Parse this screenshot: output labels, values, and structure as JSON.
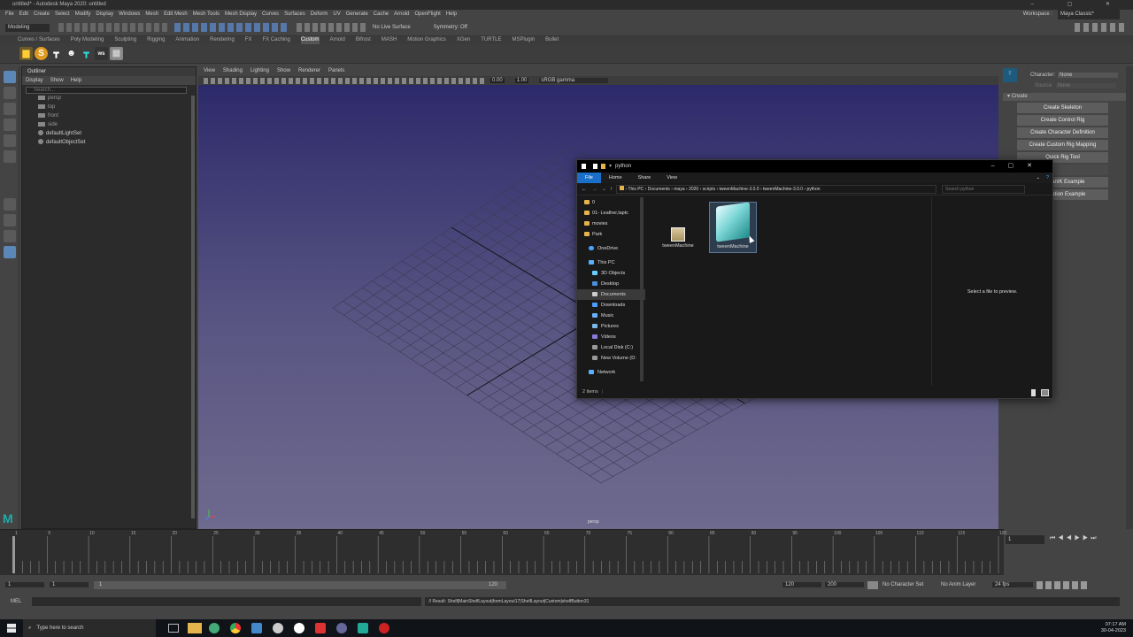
{
  "window": {
    "title": "untitled* - Autodesk Maya 2020: untitled"
  },
  "menubar": [
    "File",
    "Edit",
    "Create",
    "Select",
    "Modify",
    "Display",
    "Windows",
    "Mesh",
    "Edit Mesh",
    "Mesh Tools",
    "Mesh Display",
    "Curves",
    "Surfaces",
    "Deform",
    "UV",
    "Generate",
    "Cache",
    "Arnold",
    "OpenFlight",
    "Help"
  ],
  "workspace": {
    "label": "Workspace :",
    "value": "Maya Classic*"
  },
  "statusline": {
    "mode": "Modeling",
    "live_surface": "No Live Surface",
    "symmetry": "Symmetry: Off"
  },
  "shelf_tabs": [
    "Curves / Surfaces",
    "Poly Modeling",
    "Sculpting",
    "Rigging",
    "Animation",
    "Rendering",
    "FX",
    "FX Caching",
    "Custom",
    "Arnold",
    "Bifrost",
    "MASH",
    "Motion Graphics",
    "XGen",
    "TURTLE",
    "MSPlugin",
    "Bullet"
  ],
  "active_shelf": "Custom",
  "outliner": {
    "title": "Outliner",
    "menu": [
      "Display",
      "Show",
      "Help"
    ],
    "search_placeholder": "Search...",
    "items": [
      "persp",
      "top",
      "front",
      "side",
      "defaultLightSet",
      "defaultObjectSet"
    ]
  },
  "viewport": {
    "menu": [
      "View",
      "Shading",
      "Lighting",
      "Show",
      "Renderer",
      "Panels"
    ],
    "camera_label": "persp",
    "exposure": "0.00",
    "gamma": "1.00",
    "color_space": "sRGB gamma"
  },
  "hik": {
    "character_label": "Character:",
    "character_value": "None",
    "source_label": "Source:",
    "source_value": "None",
    "section": "Create",
    "buttons": [
      "Create Skeleton",
      "Create Control Rig",
      "Create Character Definition",
      "Create Custom Rig Mapping",
      "Quick Rig Tool",
      "HumanIK Example",
      "Animation Example"
    ]
  },
  "timeline": {
    "ticks": [
      "1",
      "5",
      "10",
      "15",
      "20",
      "25",
      "30",
      "35",
      "40",
      "45",
      "50",
      "55",
      "60",
      "65",
      "70",
      "75",
      "80",
      "85",
      "90",
      "95",
      "100",
      "105",
      "110",
      "115",
      "120"
    ],
    "current_frame": "1"
  },
  "range": {
    "start": "1",
    "start_inner": "1",
    "slider_start": "1",
    "slider_end": "120",
    "end_inner": "120",
    "end": "200",
    "character_set": "No Character Set",
    "anim_layer": "No Anim Layer",
    "fps": "24 fps"
  },
  "cmdline": {
    "label": "MEL",
    "result": "// Result: Shelf|MainShelfLayout|formLayout17|ShelfLayout|Custom|shelfButton31"
  },
  "taskbar": {
    "search_placeholder": "Type here to search",
    "time": "07:17 AM",
    "date": "30-04-2023"
  },
  "explorer": {
    "title": "python",
    "ribbon": [
      "File",
      "Home",
      "Share",
      "View"
    ],
    "breadcrumb": [
      "This PC",
      "Documents",
      "maya",
      "2020",
      "scripts",
      "tweenMachine-3.0.0",
      "tweenMachine-3.0.0",
      "python"
    ],
    "search_placeholder": "Search python",
    "nav": [
      {
        "label": "0",
        "kind": "folder"
      },
      {
        "label": "01- Leather,laptc",
        "kind": "folder"
      },
      {
        "label": "movies",
        "kind": "folder"
      },
      {
        "label": "Park",
        "kind": "folder"
      },
      {
        "label": "OneDrive",
        "kind": "cloud"
      },
      {
        "label": "This PC",
        "kind": "pc"
      },
      {
        "label": "3D Objects",
        "kind": "lib"
      },
      {
        "label": "Desktop",
        "kind": "lib"
      },
      {
        "label": "Documents",
        "kind": "lib"
      },
      {
        "label": "Downloads",
        "kind": "lib"
      },
      {
        "label": "Music",
        "kind": "lib"
      },
      {
        "label": "Pictures",
        "kind": "lib"
      },
      {
        "label": "Videos",
        "kind": "lib"
      },
      {
        "label": "Local Disk (C:)",
        "kind": "disk"
      },
      {
        "label": "New Volume (D:",
        "kind": "disk"
      },
      {
        "label": "Network",
        "kind": "net"
      }
    ],
    "files": [
      "tweenMachine",
      "tweenMachine"
    ],
    "preview_text": "Select a file to preview.",
    "status": "2 items"
  }
}
